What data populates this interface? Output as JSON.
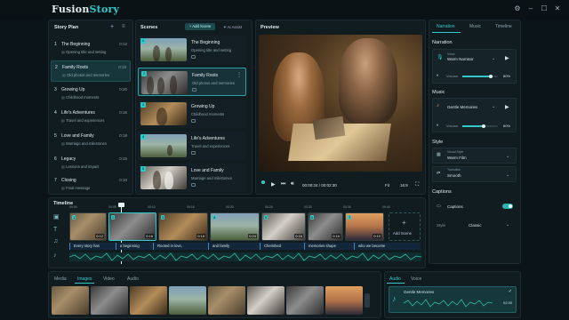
{
  "app": {
    "title_left": "Fusion",
    "title_right": "Story"
  },
  "story_plan": {
    "title": "Story Plan",
    "items": [
      {
        "num": "1",
        "title": "The Beginning",
        "time": "0:12",
        "sub": "Opening title and setting"
      },
      {
        "num": "2",
        "title": "Family Roots",
        "time": "0:18",
        "sub": "Old photos and memories"
      },
      {
        "num": "3",
        "title": "Growing Up",
        "time": "0:20",
        "sub": "Childhood moments"
      },
      {
        "num": "4",
        "title": "Life's Adventures",
        "time": "0:16",
        "sub": "Travel and experiences"
      },
      {
        "num": "5",
        "title": "Love and Family",
        "time": "0:18",
        "sub": "Marriage and milestones"
      },
      {
        "num": "6",
        "title": "Legacy",
        "time": "0:15",
        "sub": "Lessons and impact"
      },
      {
        "num": "7",
        "title": "Closing",
        "time": "0:10",
        "sub": "Final message"
      }
    ]
  },
  "scenes": {
    "title": "Scenes",
    "add_label": "+ Add Scene",
    "assist_label": "AI Assist",
    "items": [
      {
        "idx": "1",
        "title": "The Beginning",
        "sub": "Opening title and setting"
      },
      {
        "idx": "2",
        "title": "Family Roots",
        "sub": "Old photos and memories"
      },
      {
        "idx": "3",
        "title": "Growing Up",
        "sub": "Childhood moments"
      },
      {
        "idx": "4",
        "title": "Life's Adventures",
        "sub": "Travel and experiences"
      },
      {
        "idx": "5",
        "title": "Love and Family",
        "sub": "Marriage and milestones"
      }
    ]
  },
  "preview": {
    "title": "Preview",
    "time": "00:00:24 / 00:02:30",
    "fit": "Fit",
    "ratio": "16:9"
  },
  "right_panel": {
    "tabs": [
      "Narration",
      "Music",
      "Timeline"
    ],
    "narration": {
      "heading": "Narration",
      "voice_label": "Voice",
      "voice_value": "Warm Narrator",
      "volume_label": "Volume",
      "volume_value": "80%",
      "volume": 0.8
    },
    "music": {
      "heading": "Music",
      "track": "Gentle Memories",
      "volume_label": "Volume",
      "volume_value": "60%",
      "volume": 0.6
    },
    "style": {
      "heading": "Style",
      "visual_label": "Visual Style",
      "visual_value": "Warm Film",
      "transition_label": "Transition",
      "transition_value": "Smooth"
    },
    "captions": {
      "heading": "Captions",
      "toggle_label": "Captions",
      "enabled": true,
      "style_label": "Style",
      "style_value": "Classic"
    }
  },
  "timeline": {
    "title": "Timeline",
    "ruler": [
      "00:00",
      "00:05",
      "00:10",
      "00:15",
      "00:20",
      "00:25",
      "00:30",
      "00:35",
      "00:40",
      "00:45"
    ],
    "clips": [
      {
        "idx": "1",
        "dur": "0:12"
      },
      {
        "idx": "2",
        "dur": "0:16"
      },
      {
        "idx": "3",
        "dur": "0:18"
      },
      {
        "idx": "4",
        "dur": "0:24"
      },
      {
        "idx": "5",
        "dur": "0:16"
      },
      {
        "idx": "6",
        "dur": "0:16"
      },
      {
        "idx": "7",
        "dur": "0:10"
      }
    ],
    "add_scene": "Add Scene",
    "captions": [
      "Every story has",
      "a beginning",
      "Rooted in love,",
      "and family",
      "Cherished",
      "memories shape",
      "who we become"
    ]
  },
  "media": {
    "tabs": [
      "Media",
      "Images",
      "Video",
      "Audio"
    ],
    "audio_tabs": [
      "Audio",
      "Voice"
    ],
    "audio_track": "Gentle Memories",
    "audio_time": "02:30"
  }
}
